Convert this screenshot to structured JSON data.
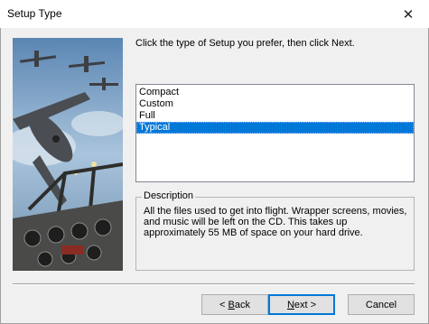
{
  "window": {
    "title": "Setup Type",
    "close_glyph": "✕"
  },
  "instruction": "Click the type of Setup you prefer, then click Next.",
  "setup_types": {
    "items": [
      {
        "label": "Compact"
      },
      {
        "label": "Custom"
      },
      {
        "label": "Full"
      },
      {
        "label": "Typical"
      }
    ],
    "selected": "Typical"
  },
  "description": {
    "legend": "Description",
    "text": "All the files used to get into flight. Wrapper screens, movies, and music will be left on the CD. This takes up approximately 55 MB of space on your hard drive."
  },
  "buttons": {
    "back_prefix": "< ",
    "back_hotkey": "B",
    "back_rest": "ack",
    "next_hotkey": "N",
    "next_rest": "ext >",
    "cancel": "Cancel"
  },
  "colors": {
    "selection": "#0078d7",
    "sky": "#7fa6c8",
    "cockpit": "#4a4a48"
  }
}
